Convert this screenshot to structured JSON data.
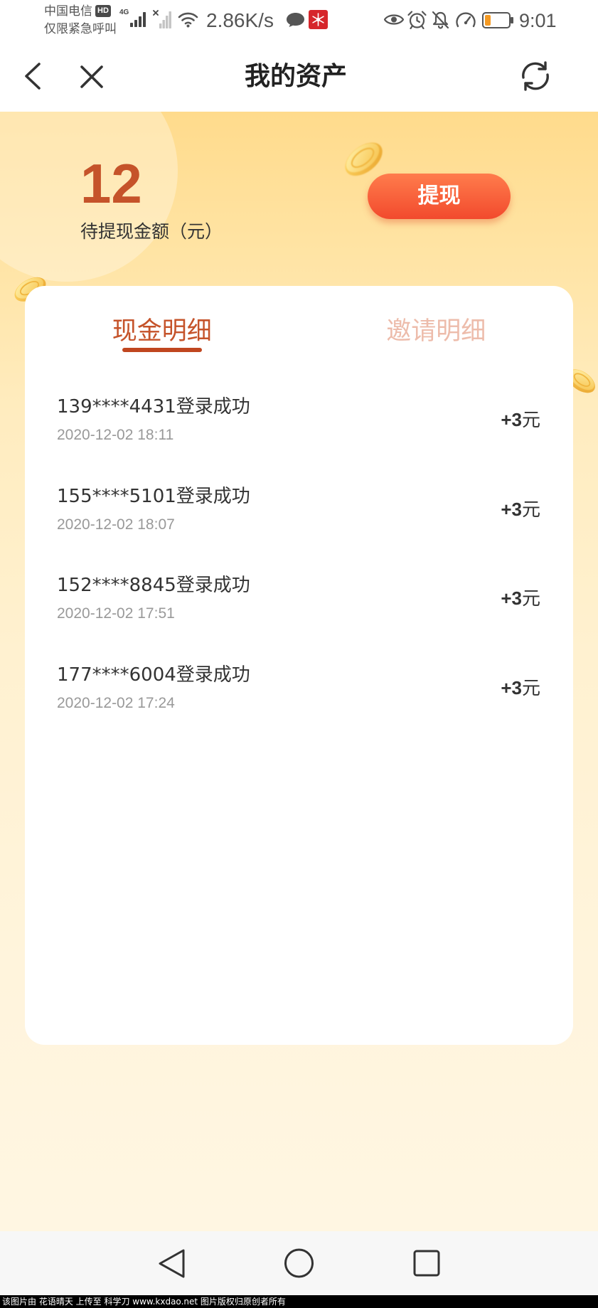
{
  "status_bar": {
    "carrier": "中国电信",
    "hd_badge": "HD",
    "emergency_only": "仅限紧急呼叫",
    "network_type": "4G",
    "net_speed": "2.86K/s",
    "time": "9:01",
    "battery_level": 0.25,
    "icons": [
      "signal-icon",
      "no-sim-signal-icon",
      "wifi-icon",
      "message-icon",
      "app-notification-icon",
      "eye-icon",
      "alarm-icon",
      "bell-off-icon",
      "gauge-icon",
      "battery-icon"
    ]
  },
  "header": {
    "title": "我的资产",
    "icons": {
      "back": "back-icon",
      "close": "close-icon",
      "refresh": "refresh-icon"
    }
  },
  "assets": {
    "amount": "12",
    "amount_label": "待提现金额（元）",
    "withdraw_button": "提现"
  },
  "tabs": [
    {
      "label": "现金明细",
      "active": true
    },
    {
      "label": "邀请明细",
      "active": false
    }
  ],
  "records": [
    {
      "title": "139****4431登录成功",
      "time": "2020-12-02 18:11",
      "amount": "+3",
      "unit": "元"
    },
    {
      "title": "155****5101登录成功",
      "time": "2020-12-02 18:07",
      "amount": "+3",
      "unit": "元"
    },
    {
      "title": "152****8845登录成功",
      "time": "2020-12-02 17:51",
      "amount": "+3",
      "unit": "元"
    },
    {
      "title": "177****6004登录成功",
      "time": "2020-12-02 17:24",
      "amount": "+3",
      "unit": "元"
    }
  ],
  "nav_bar": {
    "icons": [
      "back-triangle-icon",
      "home-circle-icon",
      "recents-square-icon"
    ]
  },
  "watermark": "该图片由 花语晴天 上传至 科学刀 www.kxdao.net 图片版权归原创者所有",
  "colors": {
    "accent": "#c5532a",
    "tab_inactive": "#edbcab",
    "tab_indicator": "#c0461f",
    "button_start": "#ff7c4c",
    "button_end": "#f24a2d",
    "hero_bg": "#ffdb8c",
    "page_bg": "#fff4dc",
    "battery_fill": "#f59a23",
    "nav_bg": "#f7f7f7"
  }
}
